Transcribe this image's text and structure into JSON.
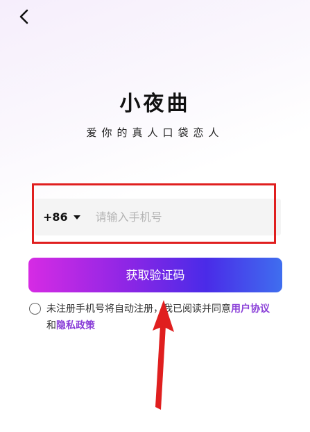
{
  "header": {
    "back_icon": "chevron-left-icon"
  },
  "brand": {
    "title": "小夜曲",
    "slogan": "爱你的真人口袋恋人"
  },
  "login": {
    "country_code": "+86",
    "phone_placeholder": "请输入手机号",
    "phone_value": "",
    "get_code_label": "获取验证码"
  },
  "agreement": {
    "prefix": "未注册手机号将自动注册，我已阅读并同意",
    "user_agreement": "用户协议",
    "conjunction": "和",
    "privacy_policy": "隐私政策"
  },
  "colors": {
    "button_gradient": [
      "#d62be4",
      "#8b26e5",
      "#4a2be8",
      "#3f6eef"
    ],
    "link": "#8a3fd8",
    "annotation_red": "#e01f1f"
  }
}
